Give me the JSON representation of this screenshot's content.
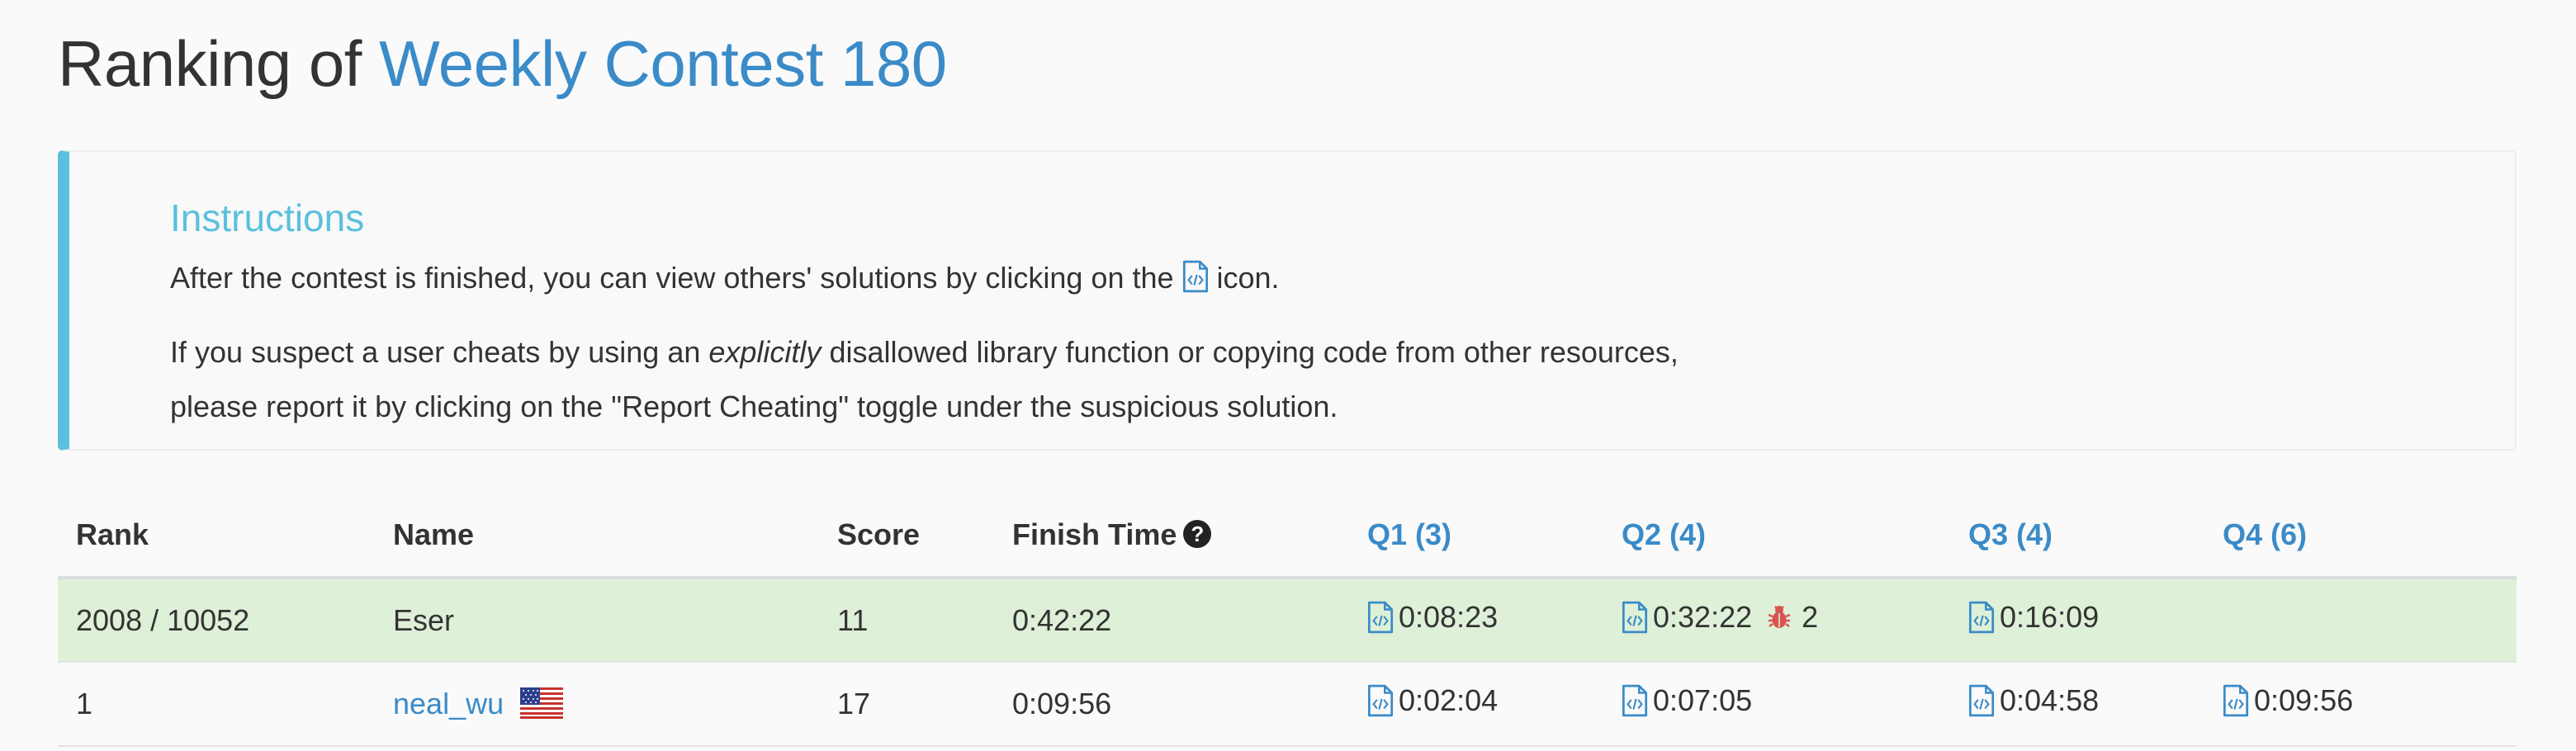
{
  "header": {
    "prefix": "Ranking of ",
    "contest_name": "Weekly Contest 180"
  },
  "instructions": {
    "title": "Instructions",
    "line1_before": "After the contest is finished, you can view others' solutions by clicking on the ",
    "line1_after": " icon.",
    "line2_before": "If you suspect a user cheats by using an ",
    "line2_em": "explicitly",
    "line2_after": " disallowed library function or copying code from other resources,",
    "line3": "please report it by clicking on the \"Report Cheating\" toggle under the suspicious solution."
  },
  "table": {
    "headers": {
      "rank": "Rank",
      "name": "Name",
      "score": "Score",
      "finish_time": "Finish Time",
      "q1": "Q1 (3)",
      "q2": "Q2 (4)",
      "q3": "Q3 (4)",
      "q4": "Q4 (6)"
    },
    "rows": [
      {
        "rank": "2008 / 10052",
        "name": "Eser",
        "score": "11",
        "finish_time": "0:42:22",
        "q1": "0:08:23",
        "q2": "0:32:22",
        "q2_wrong": "2",
        "q3": "0:16:09",
        "q4": ""
      },
      {
        "rank": "1",
        "name": "neal_wu",
        "flag": "us-flag",
        "score": "17",
        "finish_time": "0:09:56",
        "q1": "0:02:04",
        "q2": "0:07:05",
        "q3": "0:04:58",
        "q4": "0:09:56"
      }
    ]
  },
  "colors": {
    "link": "#3a8bc8",
    "info": "#5bc0de",
    "highlight_row": "#dff0d8",
    "bug": "#d9534f"
  },
  "icons": {
    "solution": "code-file-icon",
    "help": "question-circle-icon",
    "wrong": "bug-icon"
  }
}
